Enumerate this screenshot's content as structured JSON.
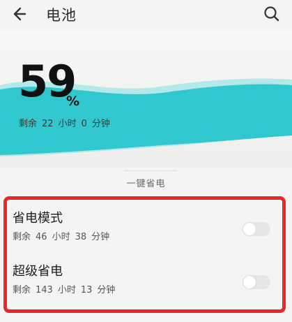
{
  "header": {
    "title": "电池",
    "back_icon": "back-arrow-icon",
    "search_icon": "search-icon"
  },
  "battery": {
    "percent": "59",
    "unit": "%",
    "level_fraction": 0.59,
    "remaining": {
      "label": "剩余",
      "hours": "22",
      "hours_unit": "小时",
      "minutes": "0",
      "minutes_unit": "分钟"
    }
  },
  "section": {
    "label": "一键省电"
  },
  "modes": [
    {
      "title": "省电模式",
      "remaining_label": "剩余",
      "hours": "46",
      "hours_unit": "小时",
      "minutes": "38",
      "minutes_unit": "分钟",
      "enabled": false
    },
    {
      "title": "超级省电",
      "remaining_label": "剩余",
      "hours": "143",
      "hours_unit": "小时",
      "minutes": "13",
      "minutes_unit": "分钟",
      "enabled": false
    }
  ],
  "colors": {
    "wave": "#30c7cf",
    "wave_light": "#7fe0e3",
    "highlight": "#e8282b"
  }
}
